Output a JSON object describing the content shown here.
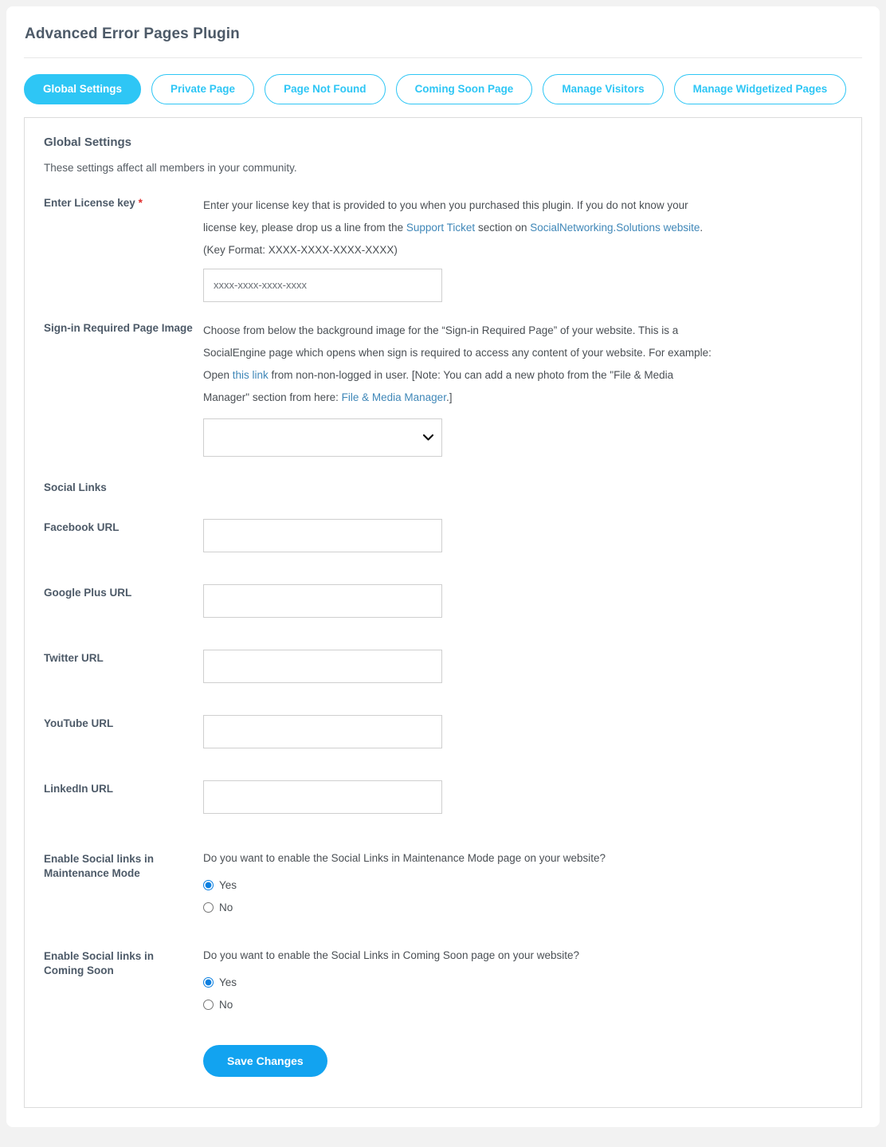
{
  "app": {
    "title": "Advanced Error Pages Plugin"
  },
  "tabs": [
    {
      "label": "Global Settings",
      "active": true
    },
    {
      "label": "Private Page",
      "active": false
    },
    {
      "label": "Page Not Found",
      "active": false
    },
    {
      "label": "Coming Soon Page",
      "active": false
    },
    {
      "label": "Manage Visitors",
      "active": false
    },
    {
      "label": "Manage Widgetized Pages",
      "active": false
    }
  ],
  "panel": {
    "title": "Global Settings",
    "subtitle": "These settings affect all members in your community."
  },
  "license": {
    "label": "Enter License key",
    "required_mark": "*",
    "desc_1": "Enter your license key that is provided to you when you purchased this plugin. If you do not know your license key, please drop us a line from the ",
    "link_support": "Support Ticket",
    "desc_2": " section on ",
    "link_website": "SocialNetworking.Solutions website",
    "desc_3": ".",
    "key_format": "(Key Format: XXXX-XXXX-XXXX-XXXX)",
    "placeholder": "xxxx-xxxx-xxxx-xxxx",
    "value": ""
  },
  "signin_image": {
    "label": "Sign-in Required Page Image",
    "desc_1": "Choose from below the background image for the “Sign-in Required Page” of your website. This is a SocialEngine page which opens when sign is required to access any content of your website. For example: Open ",
    "link_this": "this link",
    "desc_2": " from non-non-logged in user. [Note: You can add a new photo from the \"File & Media Manager\" section from here: ",
    "link_media": "File & Media Manager",
    "desc_3": ".]",
    "selected_option": "",
    "options": [
      ""
    ]
  },
  "social_links": {
    "group_label": "Social Links",
    "fields": [
      {
        "label": "Facebook URL",
        "value": "",
        "placeholder": ""
      },
      {
        "label": "Google Plus URL",
        "value": "",
        "placeholder": ""
      },
      {
        "label": "Twitter URL",
        "value": "",
        "placeholder": ""
      },
      {
        "label": "YouTube URL",
        "value": "",
        "placeholder": ""
      },
      {
        "label": "LinkedIn URL",
        "value": "",
        "placeholder": ""
      }
    ]
  },
  "enable_maintenance": {
    "label": "Enable Social links in Maintenance Mode",
    "question": "Do you want to enable the Social Links in Maintenance Mode page on your website?",
    "option_yes": "Yes",
    "option_no": "No",
    "selected": "Yes"
  },
  "enable_coming_soon": {
    "label": "Enable Social links in Coming Soon",
    "question": "Do you want to enable the Social Links in Coming Soon page on your website?",
    "option_yes": "Yes",
    "option_no": "No",
    "selected": "Yes"
  },
  "actions": {
    "save_label": "Save Changes"
  },
  "colors": {
    "accent_cyan": "#2ec6f5",
    "button_blue": "#12a3f0",
    "link_blue": "#3f87b8",
    "required_red": "#e02b2b",
    "label_gray": "#4d5a68",
    "page_bg": "#f2f2f2"
  }
}
